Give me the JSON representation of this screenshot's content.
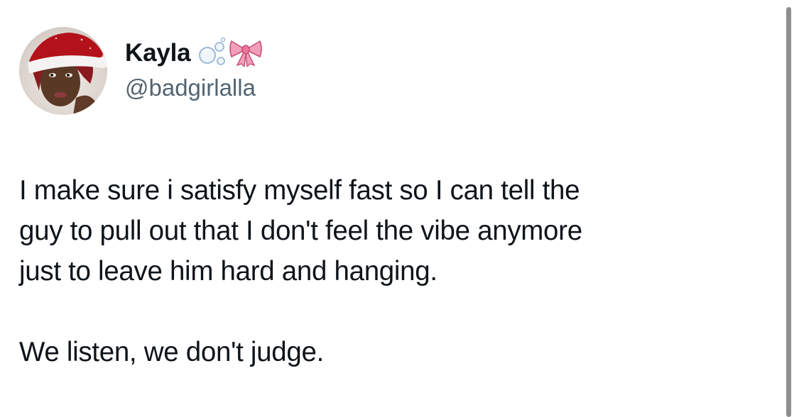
{
  "user": {
    "display_name": "Kayla",
    "handle": "@badgirlalla",
    "name_emojis": [
      "bubbles-icon",
      "ribbon-icon"
    ]
  },
  "tweet": {
    "lines": [
      "I make sure i satisfy myself fast so I can tell the",
      "guy to pull out that I don't feel the vibe anymore",
      "just to leave him hard and hanging."
    ],
    "closing": "We listen, we don't judge."
  },
  "colors": {
    "text": "#0f1419",
    "secondary_text": "#536471",
    "background": "#ffffff",
    "scrollbar": "#8e8e8e"
  }
}
